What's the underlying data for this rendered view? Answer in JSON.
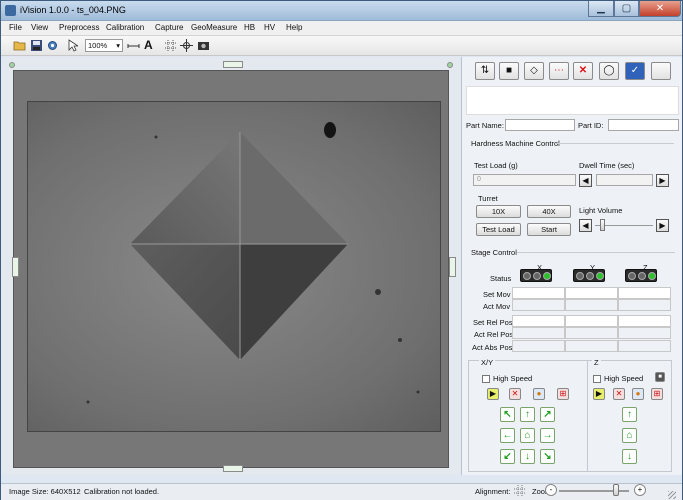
{
  "window": {
    "title": "iVision 1.0.0 - ts_004.PNG",
    "min": "▁",
    "max": "▢",
    "close": "✕"
  },
  "menu": [
    "File",
    "View",
    "Preprocess",
    "Calibration",
    "Capture",
    "GeoMeasure",
    "HB",
    "HV",
    "Help"
  ],
  "toolbar": {
    "zoom_value": "100%",
    "text_tool": "A"
  },
  "right_toolbar_icons": [
    "step-icon",
    "camera-icon",
    "diamond-icon",
    "dashed-rect-icon",
    "delete-icon",
    "circle-icon",
    "check-icon",
    "blank-icon"
  ],
  "part": {
    "name_label": "Part Name:",
    "name_value": "",
    "id_label": "Part ID:",
    "id_value": ""
  },
  "hardness": {
    "section_title": "Hardness Machine Control",
    "test_load_label": "Test Load (g)",
    "test_load_value": "0",
    "dwell_label": "Dwell Time (sec)",
    "turret_label": "Turret",
    "btn_10x": "10X",
    "btn_40x": "40X",
    "btn_test_load": "Test Load",
    "btn_start": "Start",
    "light_label": "Light Volume",
    "light_level": 0.1
  },
  "stage": {
    "section_title": "Stage Control",
    "axes": [
      "X",
      "Y",
      "Z"
    ],
    "status_label": "Status",
    "rows": [
      "Set Mov",
      "Act Mov",
      "Set Rel Pos",
      "Act Rel Pos",
      "Act Abs Pos"
    ],
    "xy_label": "X/Y",
    "z_label": "Z",
    "high_speed": "High Speed"
  },
  "status": {
    "image_size": "Image Size: 640X512",
    "calibration": "Calibration not loaded.",
    "alignment_label": "Alignment:",
    "zoom_label": "Zoom:",
    "zoom_minus": "-",
    "zoom_plus": "+"
  }
}
